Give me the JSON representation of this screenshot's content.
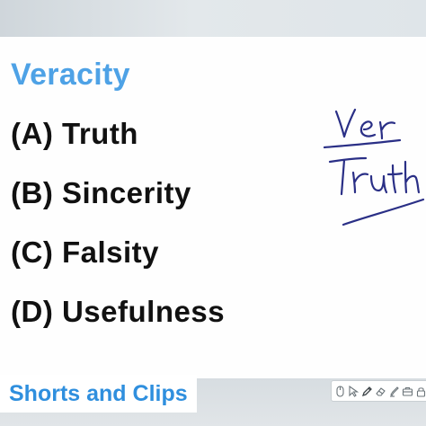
{
  "question": {
    "title": "Veracity",
    "options": [
      "(A) Truth",
      "(B) Sincerity",
      "(C) Falsity",
      "(D) Usefulness"
    ]
  },
  "overlay": {
    "caption": "Shorts and Clips"
  },
  "handwriting": {
    "lines": [
      "Ver",
      "Truth"
    ],
    "ink_color": "#2a2f86"
  },
  "toolbar": {
    "icons": [
      "mouse-icon",
      "cursor-arrow-icon",
      "pen-icon",
      "eraser-icon",
      "highlighter-icon",
      "toolbox-icon",
      "lock-icon"
    ]
  },
  "colors": {
    "title": "#4ea2e6",
    "caption": "#2f8fde",
    "option_text": "#111111",
    "accent_green": "#22c25a"
  }
}
